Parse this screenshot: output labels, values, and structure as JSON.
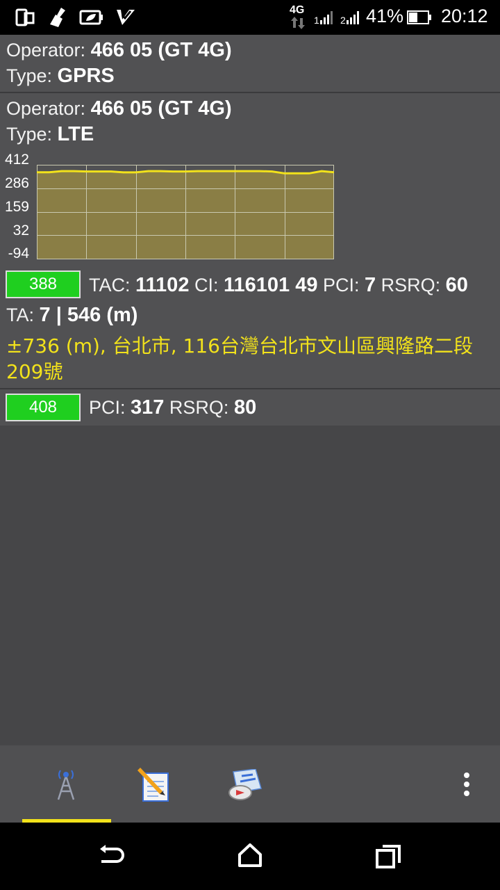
{
  "status_bar": {
    "network_label": "4G",
    "sim2_label": "2",
    "battery_percent": "41%",
    "time": "20:12"
  },
  "cells": [
    {
      "operator_label": "Operator: ",
      "operator_value": "466 05 (GT 4G)",
      "type_label": "Type: ",
      "type_value": "GPRS"
    },
    {
      "operator_label": "Operator: ",
      "operator_value": "466 05 (GT 4G)",
      "type_label": "Type: ",
      "type_value": "LTE",
      "serving": {
        "channel": "388",
        "tac_label": "TAC: ",
        "tac_value": "11102",
        "ci_label": "CI: ",
        "ci_value": "116101 49",
        "pci_label": "PCI: ",
        "pci_value": "7",
        "rsrq_label": "RSRQ: ",
        "rsrq_value": "60",
        "ta_label": "TA: ",
        "ta_value": "7 | 546 (m)",
        "location": "±736 (m), 台北市, 116台灣台北市文山區興隆路二段209號"
      },
      "neighbor": {
        "channel": "408",
        "pci_label": "PCI: ",
        "pci_value": "317",
        "rsrq_label": "RSRQ: ",
        "rsrq_value": "80"
      }
    }
  ],
  "chart_data": {
    "type": "area",
    "y_tick_labels": [
      "412",
      "286",
      "159",
      "32",
      "-94"
    ],
    "ylim": [
      -94,
      412
    ],
    "grid": true,
    "line_color": "#f2e21b",
    "fill_color": "#8a7e45",
    "values": [
      372,
      372,
      378,
      378,
      376,
      376,
      376,
      371,
      371,
      378,
      378,
      376,
      376,
      378,
      378,
      378,
      378,
      378,
      378,
      376,
      366,
      366,
      366,
      378,
      372
    ]
  },
  "toolbar": {
    "tabs": [
      {
        "icon": "cell-tower-icon",
        "active": true
      },
      {
        "icon": "notepad-icon",
        "active": false
      },
      {
        "icon": "map-compass-icon",
        "active": false
      }
    ],
    "overflow_icon": "overflow-menu-icon"
  },
  "navbar": {
    "icons": [
      "back-icon",
      "home-icon",
      "recents-icon"
    ]
  }
}
